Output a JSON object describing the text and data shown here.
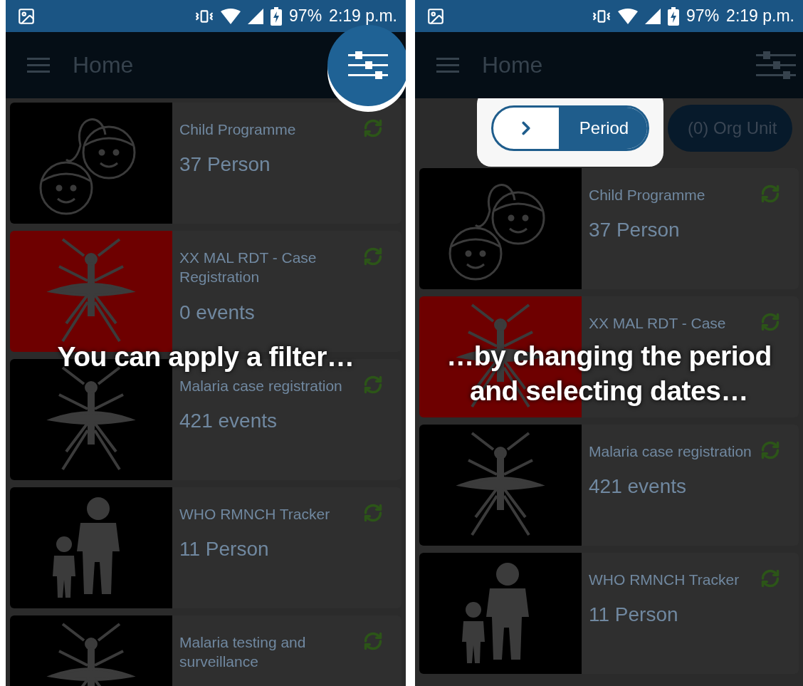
{
  "screens": [
    {
      "status_bar": {
        "battery": "97%",
        "time": "2:19 p.m."
      },
      "toolbar": {
        "title": "Home",
        "filter_highlighted": true
      },
      "programs": [
        {
          "title": "Child Programme",
          "count": "37 Person",
          "kind": "children",
          "color": "#000000"
        },
        {
          "title": "XX MAL RDT - Case Registration",
          "count": "0 events",
          "kind": "mosquito",
          "color": "#6e0000"
        },
        {
          "title": "Malaria case registration",
          "count": "421 events",
          "kind": "mosquito",
          "color": "#000000"
        },
        {
          "title": "WHO RMNCH Tracker",
          "count": "11 Person",
          "kind": "family",
          "color": "#000000"
        },
        {
          "title": "Malaria testing and surveillance",
          "kind": "mosquito",
          "color": "#000000"
        }
      ],
      "caption": [
        "You can apply a filter…"
      ]
    },
    {
      "status_bar": {
        "battery": "97%",
        "time": "2:19 p.m."
      },
      "toolbar": {
        "title": "Home",
        "filter_highlighted": false
      },
      "filter_chips": [
        {
          "kind": "period",
          "label": "Period",
          "highlighted": true
        },
        {
          "kind": "org_unit",
          "label": "(0) Org Unit",
          "highlighted": false
        }
      ],
      "programs": [
        {
          "title": "Child Programme",
          "count": "37 Person",
          "kind": "children",
          "color": "#000000"
        },
        {
          "title": "XX MAL RDT - Case",
          "kind": "mosquito",
          "color": "#6e0000"
        },
        {
          "title": "Malaria case registration",
          "count": "421 events",
          "kind": "mosquito",
          "color": "#000000"
        },
        {
          "title": "WHO RMNCH Tracker",
          "count": "11 Person",
          "kind": "family",
          "color": "#000000"
        }
      ],
      "caption": [
        "…by changing the period",
        "and selecting dates…"
      ]
    }
  ]
}
